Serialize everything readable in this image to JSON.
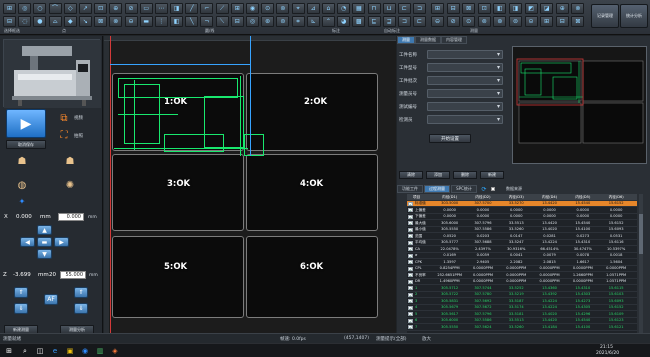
{
  "toolbar": {
    "groups": [
      "选择框选",
      "点",
      "圆/线",
      "标注",
      "自动标注",
      "测量"
    ],
    "right_buttons": {
      "record": "记录管理",
      "stats": "统计分析"
    },
    "row1_icons": [
      "⊞",
      "◎",
      "○",
      "⌒",
      "◇",
      "↗",
      "⊡",
      "⊕",
      "⊘",
      "▭",
      "⋯",
      "◨",
      "╱",
      "⌐",
      "⟋",
      "⊞",
      "◉",
      "⊙",
      "⊚",
      "⌖",
      "⊿",
      "⌂",
      "◔",
      "▦",
      "⊓",
      "⊔",
      "⊏",
      "⊐"
    ],
    "row2_icons": [
      "⊟",
      "◌",
      "●",
      "⌓",
      "◆",
      "↘",
      "⊠",
      "⊗",
      "⊖",
      "▬",
      "⋮",
      "◧",
      "╲",
      "¬",
      "⟍",
      "⊟",
      "◎",
      "⊛",
      "⊜",
      "⌗",
      "⊾",
      "⌃",
      "◕",
      "▩",
      "⊑",
      "⊒",
      "⊐",
      "⊏"
    ],
    "row1_icons_b": [
      "⊞",
      "⊟",
      "⊠",
      "⊡",
      "◧",
      "◨",
      "◩",
      "◪",
      "⊕",
      "⊗"
    ],
    "row2_icons_b": [
      "⊖",
      "⊘",
      "⊙",
      "⊚",
      "⊛",
      "⊜",
      "⊝",
      "⊞",
      "⊟",
      "⊠"
    ]
  },
  "left_panel": {
    "buttons": {
      "vision": "视频",
      "shoot_save": "取消保存",
      "photo": "拍照",
      "new_meas": "新建测量",
      "open_meas": "测量分析"
    },
    "x_value": "0.000",
    "x_unit": "mm",
    "x_input": "0.000",
    "z_value": "-3.699",
    "z_unit": "mm",
    "z_label": "Z",
    "z_step": "20",
    "z_input": "55.000",
    "x_label": "X",
    "af_label": "AF"
  },
  "canvas": {
    "panels": [
      "1:OK",
      "2:OK",
      "3:OK",
      "4:OK",
      "5:OK",
      "6:OK"
    ]
  },
  "right": {
    "tabs": [
      "测量",
      "测量数据",
      "内容管理"
    ],
    "form": [
      {
        "label": "工件名称"
      },
      {
        "label": "工件型号"
      },
      {
        "label": "工件批次"
      },
      {
        "label": "测量员号"
      },
      {
        "label": "测试编号"
      },
      {
        "label": "检测员"
      }
    ],
    "apply_label": "开始设置",
    "actions": [
      "清除",
      "添加",
      "删除",
      "新建"
    ],
    "table_tabs": [
      "功能工件",
      "过程测量",
      "SPC统计",
      "数据源"
    ],
    "table_export": "数据来源",
    "table": {
      "headers": [
        "项目",
        "内径(D1)",
        "内径(D2)",
        "内径(D3)",
        "内径(D4)",
        "内径(D5)",
        "内径(D6)"
      ],
      "rows": [
        {
          "name": "标准值",
          "vals": [
            "303.5000",
            "307.5700",
            "33.5270",
            "13.4420",
            "15.4540",
            "15.6152"
          ],
          "type": "sel"
        },
        {
          "name": "上偏差",
          "vals": [
            "0.0000",
            "0.0000",
            "0.0000",
            "0.0000",
            "0.0000",
            "0.0000"
          ],
          "type": "w"
        },
        {
          "name": "下偏差",
          "vals": [
            "0.0000",
            "0.0000",
            "0.0000",
            "0.0000",
            "0.0000",
            "0.0000"
          ],
          "type": "w"
        },
        {
          "name": "最大值",
          "vals": [
            "305.6000",
            "307.5796",
            "33.5513",
            "13.4420",
            "15.4540",
            "15.6152"
          ],
          "type": "w"
        },
        {
          "name": "最小值",
          "vals": [
            "305.5550",
            "307.5586",
            "33.5260",
            "13.4020",
            "15.4100",
            "15.6093"
          ],
          "type": "w"
        },
        {
          "name": "范围",
          "vals": [
            "0.0520",
            "0.0203",
            "0.0147",
            "0.0281",
            "0.0273",
            "0.0531"
          ],
          "type": "w"
        },
        {
          "name": "平均值",
          "vals": [
            "305.5777",
            "307.5688",
            "33.5247",
            "13.4224",
            "15.4310",
            "15.6116"
          ],
          "type": "w"
        },
        {
          "name": "CA",
          "vals": [
            "22.0478%",
            "2.4397%",
            "30.9316%",
            "66.4514%",
            "30.4747%",
            "10.5397%"
          ],
          "type": "w"
        },
        {
          "name": "σ",
          "vals": [
            "0.0169",
            "0.0059",
            "0.0041",
            "0.0079",
            "0.0078",
            "0.0018"
          ],
          "type": "w"
        },
        {
          "name": "CPK",
          "vals": [
            "1.3597",
            "2.9405",
            "2.2082",
            "2.0815",
            "1.6617",
            "1.5604"
          ],
          "type": "w"
        },
        {
          "name": "CPL",
          "vals": [
            "0.8254PPM",
            "0.0000PPM",
            "0.0000PPM",
            "0.0000PPM",
            "0.0000PPM",
            "0.0000PPM"
          ],
          "type": "w"
        },
        {
          "name": "不良率",
          "vals": [
            "252.6651PPM",
            "0.0000PPM",
            "0.0000PPM",
            "0.0000PPM",
            "1.2660PPM",
            "1.0571PPM"
          ],
          "type": "w"
        },
        {
          "name": "DR",
          "vals": [
            "1.4960PPM",
            "0.0000PPM",
            "0.0000PPM",
            "0.0000PPM",
            "0.0000PPM",
            "1.0571PPM"
          ],
          "type": "w"
        },
        {
          "name": "1",
          "vals": [
            "305.5712",
            "307.5744",
            "33.5252",
            "13.4360",
            "15.4310",
            "15.6115"
          ],
          "type": "g"
        },
        {
          "name": "2",
          "vals": [
            "305.5722",
            "307.5780",
            "33.5219",
            "13.4392",
            "15.4303",
            "15.6103"
          ],
          "type": "g"
        },
        {
          "name": "3",
          "vals": [
            "305.5831",
            "307.5692",
            "33.5187",
            "13.4224",
            "15.4273",
            "15.6093"
          ],
          "type": "g"
        },
        {
          "name": "4",
          "vals": [
            "305.5679",
            "307.5672",
            "33.5174",
            "13.4224",
            "15.4305",
            "15.6152"
          ],
          "type": "g"
        },
        {
          "name": "5",
          "vals": [
            "305.5617",
            "307.5796",
            "33.5181",
            "13.4020",
            "15.4296",
            "15.6109"
          ],
          "type": "g"
        },
        {
          "name": "6",
          "vals": [
            "305.6000",
            "307.5586",
            "33.5513",
            "13.4420",
            "15.4540",
            "15.6123"
          ],
          "type": "g"
        },
        {
          "name": "7",
          "vals": [
            "305.5550",
            "307.5624",
            "33.5260",
            "13.4184",
            "15.4100",
            "15.6121"
          ],
          "type": "g"
        }
      ]
    }
  },
  "status": {
    "left": "测量就绪",
    "mid1": "帧速: 0.0fps",
    "coords": "(457,1407)",
    "mid2": "测量提示(全部)",
    "right": "放大"
  },
  "taskbar": {
    "time": "21:15",
    "date": "2021/6/20",
    "icons": [
      "⊞",
      "⌕",
      "◫",
      "e",
      "▣",
      "◉",
      "▥",
      "◈"
    ]
  },
  "colors": {
    "accent": "#3f79b0",
    "ok_green": "#19e86e",
    "selected_row": "#e6862a"
  }
}
